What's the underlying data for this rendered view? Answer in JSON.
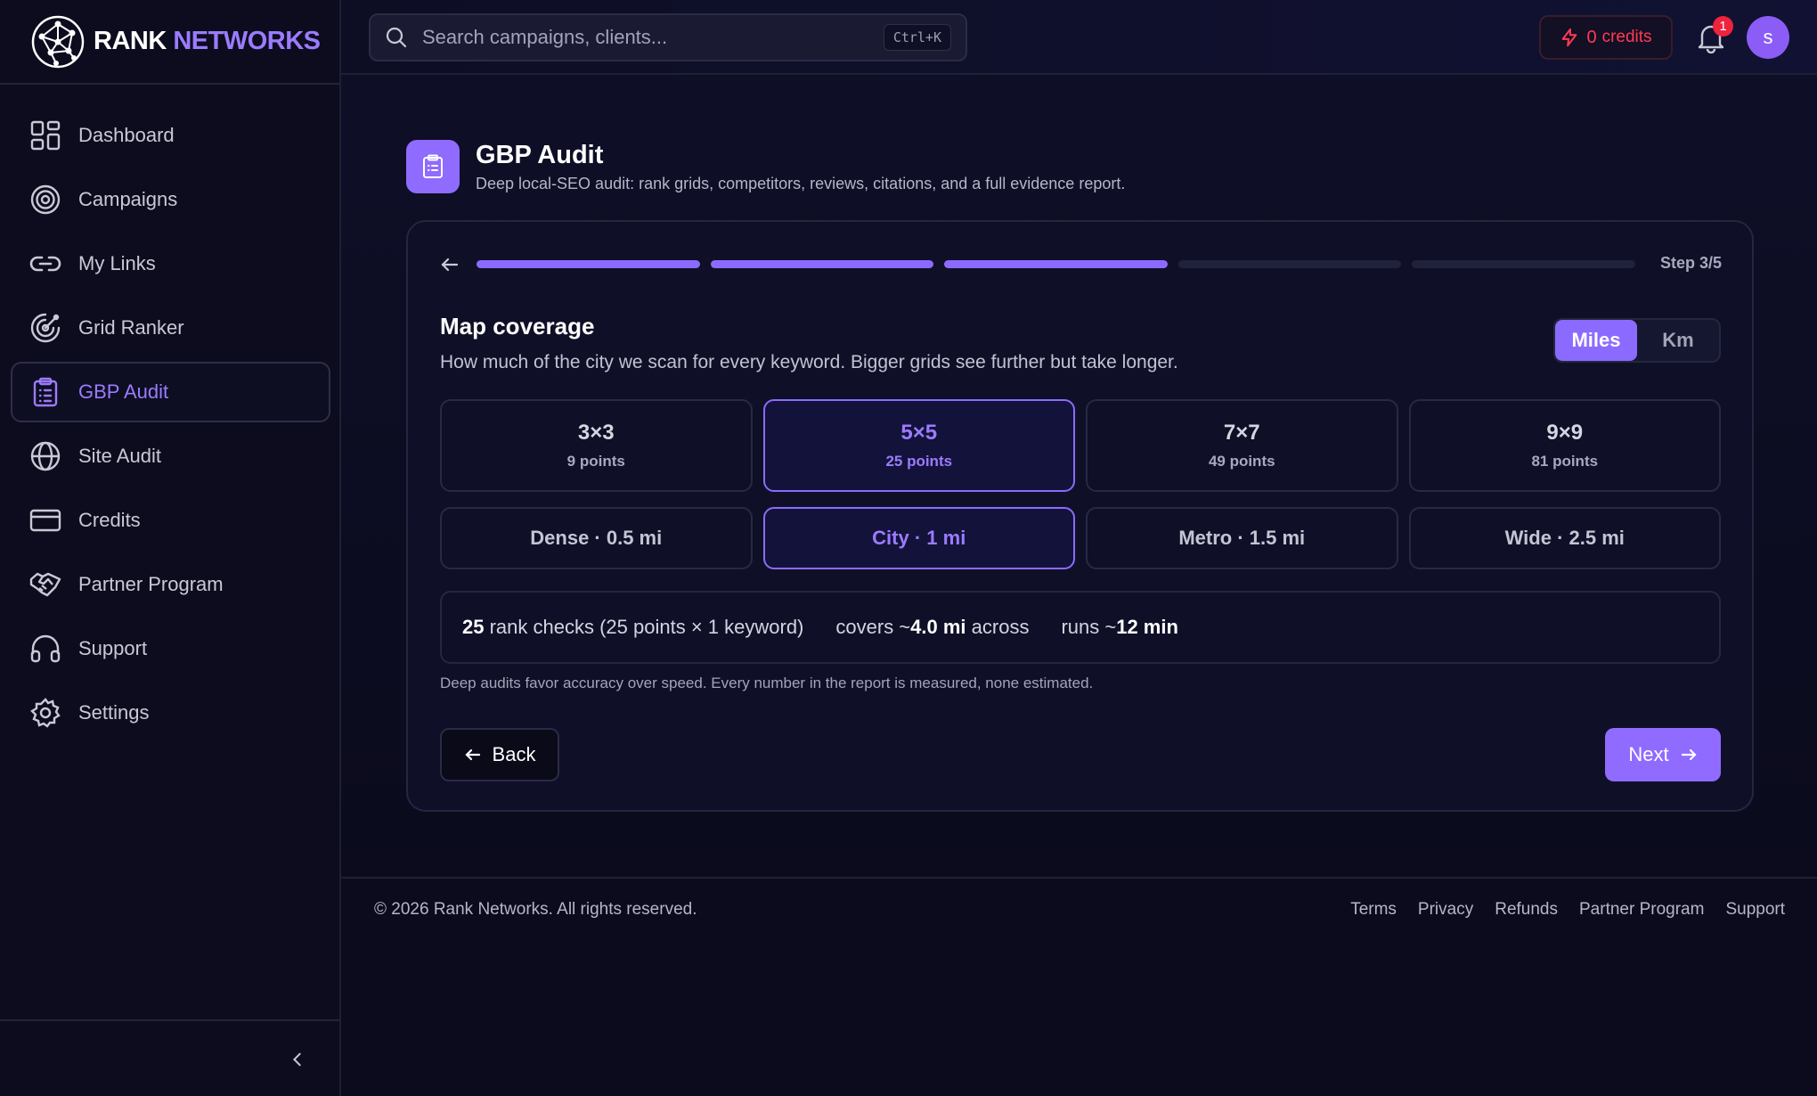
{
  "brand": {
    "word1": "RANK",
    "word2": "NETWORKS",
    "primary": "#8b6bff"
  },
  "sidebar": {
    "items": [
      {
        "label": "Dashboard",
        "icon": "dashboard-icon"
      },
      {
        "label": "Campaigns",
        "icon": "target-icon"
      },
      {
        "label": "My Links",
        "icon": "link-icon"
      },
      {
        "label": "Grid Ranker",
        "icon": "radar-icon"
      },
      {
        "label": "GBP Audit",
        "icon": "clipboard-icon",
        "active": true
      },
      {
        "label": "Site Audit",
        "icon": "globe-icon"
      },
      {
        "label": "Credits",
        "icon": "credit-card-icon"
      },
      {
        "label": "Partner Program",
        "icon": "handshake-icon"
      },
      {
        "label": "Support",
        "icon": "headphones-icon"
      },
      {
        "label": "Settings",
        "icon": "gear-icon"
      }
    ]
  },
  "topbar": {
    "search_placeholder": "Search campaigns, clients...",
    "shortcut": "Ctrl+K",
    "credits_count": "0",
    "credits_label": "credits",
    "notifications": "1",
    "avatar_initial": "s"
  },
  "page": {
    "title": "GBP Audit",
    "subtitle": "Deep local-SEO audit: rank grids, competitors, reviews, citations, and a full evidence report."
  },
  "wizard": {
    "step_label": "Step 3/5",
    "progress": {
      "current": 3,
      "total": 5
    },
    "section_title": "Map coverage",
    "section_sub": "How much of the city we scan for every keyword. Bigger grids see further but take longer.",
    "units": {
      "miles": "Miles",
      "km": "Km",
      "selected": "Miles"
    },
    "grids": [
      {
        "label": "3×3",
        "points": "9 points"
      },
      {
        "label": "5×5",
        "points": "25 points",
        "selected": true
      },
      {
        "label": "7×7",
        "points": "49 points"
      },
      {
        "label": "9×9",
        "points": "81 points"
      }
    ],
    "radii": [
      {
        "label": "Dense · 0.5 mi"
      },
      {
        "label": "City · 1 mi",
        "selected": true
      },
      {
        "label": "Metro · 1.5 mi"
      },
      {
        "label": "Wide · 2.5 mi"
      }
    ],
    "summary": {
      "checks_num": "25",
      "checks_text": "rank checks (25 points × 1 keyword)",
      "covers_prefix": "covers ~",
      "covers_value": "4.0 mi",
      "covers_suffix": "across",
      "runs_prefix": "runs ~",
      "runs_value": "12 min"
    },
    "note": "Deep audits favor accuracy over speed. Every number in the report is measured, none estimated.",
    "back_label": "Back",
    "next_label": "Next"
  },
  "footer": {
    "copyright": "© 2026 Rank Networks. All rights reserved.",
    "links": [
      "Terms",
      "Privacy",
      "Refunds",
      "Partner Program",
      "Support"
    ]
  }
}
